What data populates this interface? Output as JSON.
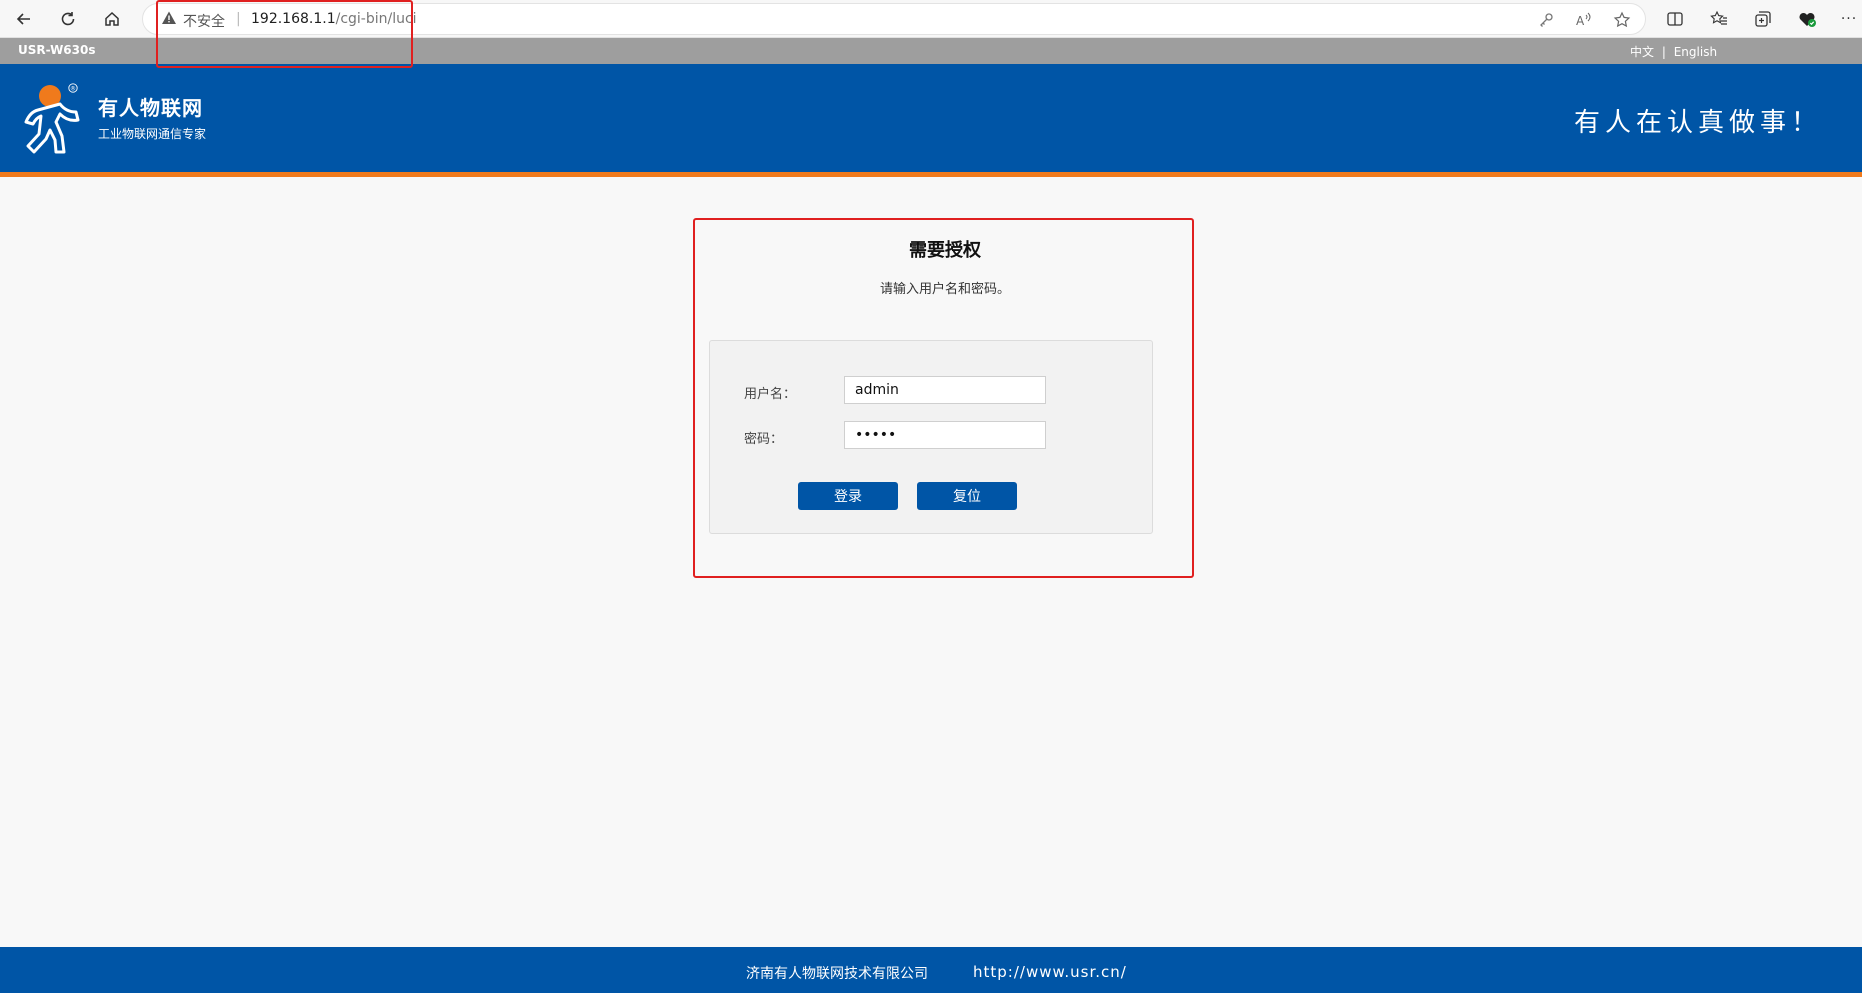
{
  "browser": {
    "insecure_label": "不安全",
    "separator": "|",
    "url_host": "192.168.1.1",
    "url_path": "/cgi-bin/luci",
    "more_label": "···"
  },
  "top_strip": {
    "device_name": "USR-W630s",
    "lang_zh": "中文",
    "lang_sep": "|",
    "lang_en": "English"
  },
  "header": {
    "brand_name": "有人物联网",
    "brand_sub": "工业物联网通信专家",
    "registered_mark": "®",
    "slogan": "有人在认真做事！"
  },
  "login": {
    "title": "需要授权",
    "description": "请输入用户名和密码。",
    "username_label": "用户名：",
    "username_value": "admin",
    "password_label": "密码：",
    "password_value": "admin",
    "login_button": "登录",
    "reset_button": "复位"
  },
  "footer": {
    "company": "济南有人物联网技术有限公司",
    "url": "http://www.usr.cn/"
  },
  "colors": {
    "brand_blue": "#0055a6",
    "accent_orange": "#f07a1c",
    "annotation_red": "#e02020"
  }
}
